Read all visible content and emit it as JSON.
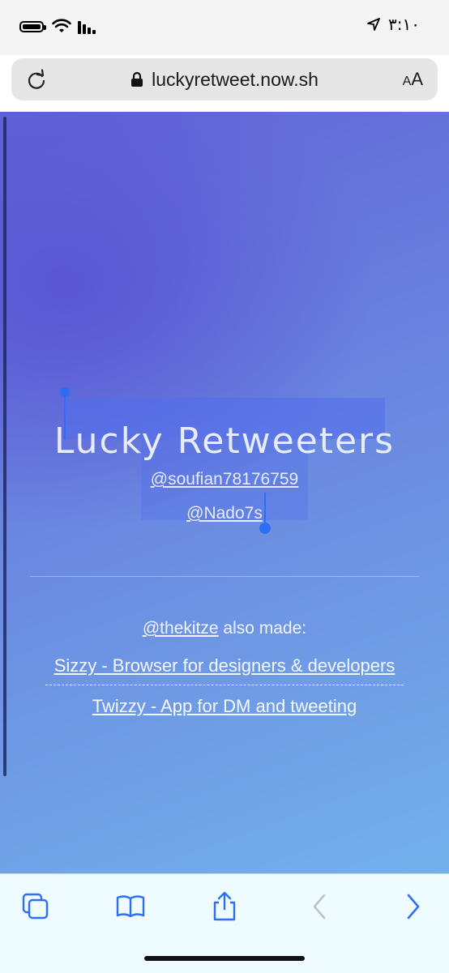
{
  "status_bar": {
    "time": "٣:١٠",
    "icons": [
      "battery-icon",
      "wifi-icon",
      "signal-icon",
      "location-arrow-icon"
    ]
  },
  "url_bar": {
    "url": "luckyretweet.now.sh",
    "reader_label": "AA",
    "icons": [
      "reload-icon",
      "lock-icon"
    ]
  },
  "page": {
    "title": "Lucky Retweeters",
    "winners": [
      "@soufian78176759",
      "@Nado7s"
    ],
    "made_by_handle": "@thekitze",
    "made_by_suffix": " also made:",
    "projects": [
      "Sizzy - Browser for designers & developers",
      "Twizzy - App for DM and tweeting"
    ]
  },
  "toolbar": {
    "icons": [
      "tabs-icon",
      "bookmarks-icon",
      "share-icon",
      "back-icon",
      "forward-icon"
    ]
  },
  "colors": {
    "accent": "#2f6ef4",
    "gradient_start": "#5850d2",
    "gradient_end": "#73b1ea"
  }
}
